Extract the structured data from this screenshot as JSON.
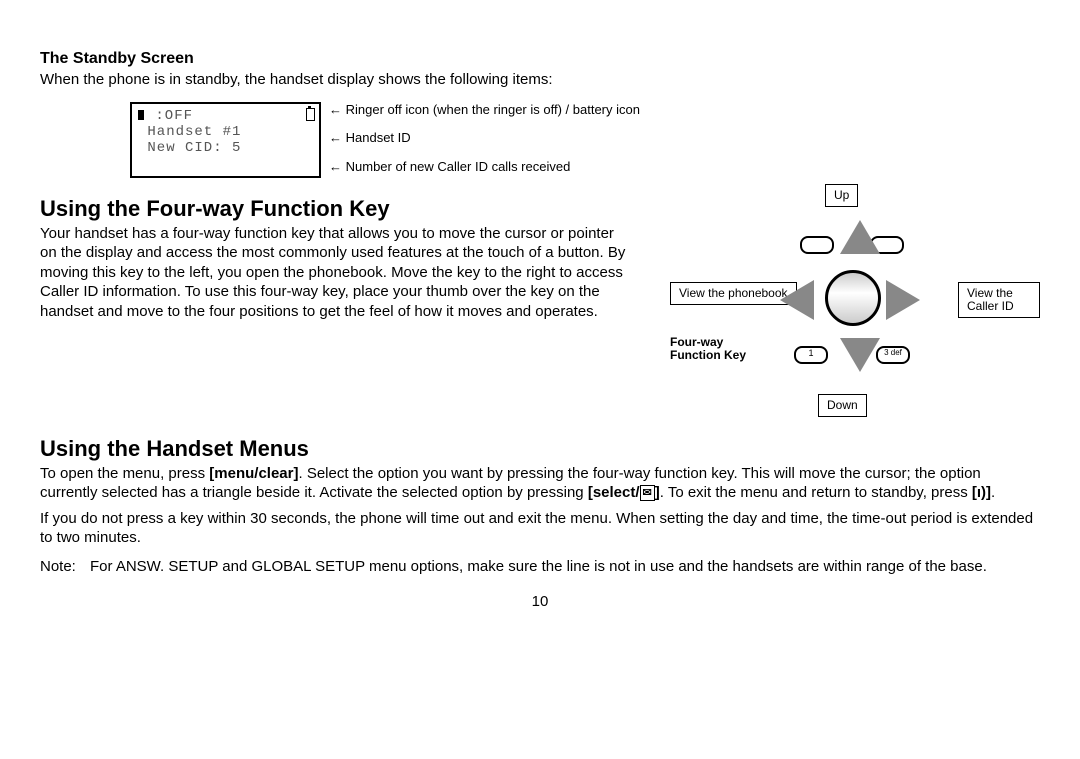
{
  "standby": {
    "title": "The Standby Screen",
    "intro": "When the phone is in standby, the handset display shows the following items:",
    "lcd_line1": " :OFF",
    "lcd_line2": " Handset #1",
    "lcd_line3": " New CID: 5",
    "annot1": "Ringer off icon (when the ringer is off) / battery icon",
    "annot2": "Handset ID",
    "annot3": "Number of new Caller ID calls received"
  },
  "fourway": {
    "title": "Using the Four-way Function Key",
    "body": "Your handset has a four-way function key that allows you to move the cursor or pointer on the display and access the most commonly used features at the touch of a button. By moving this key to the left, you open the phonebook. Move the key to the right to access Caller ID information. To use this four-way key, place your thumb over the key on the handset and move to the four positions to get the feel of how it moves and operates.",
    "label_up": "Up",
    "label_down": "Down",
    "label_left": "View the phonebook",
    "label_right": "View the Caller ID",
    "label_key": "Four-way Function Key",
    "key_1": "1",
    "key_3": "3 def"
  },
  "menus": {
    "title": "Using the Handset Menus",
    "p1a": "To open the menu, press ",
    "p1b": "[menu/clear]",
    "p1c": ". Select the option you want by pressing the four-way function key. This will move the cursor; the option currently selected has a triangle beside it. Activate the selected option by pressing ",
    "p1d": "[select/",
    "p1e": "]",
    "p1f": ". To exit the menu and return to standby, press ",
    "p1g": "[",
    "p1h": "]",
    "p1i": ".",
    "p2": "If you do not press a key within 30 seconds, the phone will time out and exit the menu. When setting the day and time, the time-out period is extended to two minutes.",
    "note_label": "Note:",
    "note_body": "For ANSW. SETUP and GLOBAL SETUP menu options, make sure the line is not in use and the handsets are within range of the base."
  },
  "page_number": "10"
}
